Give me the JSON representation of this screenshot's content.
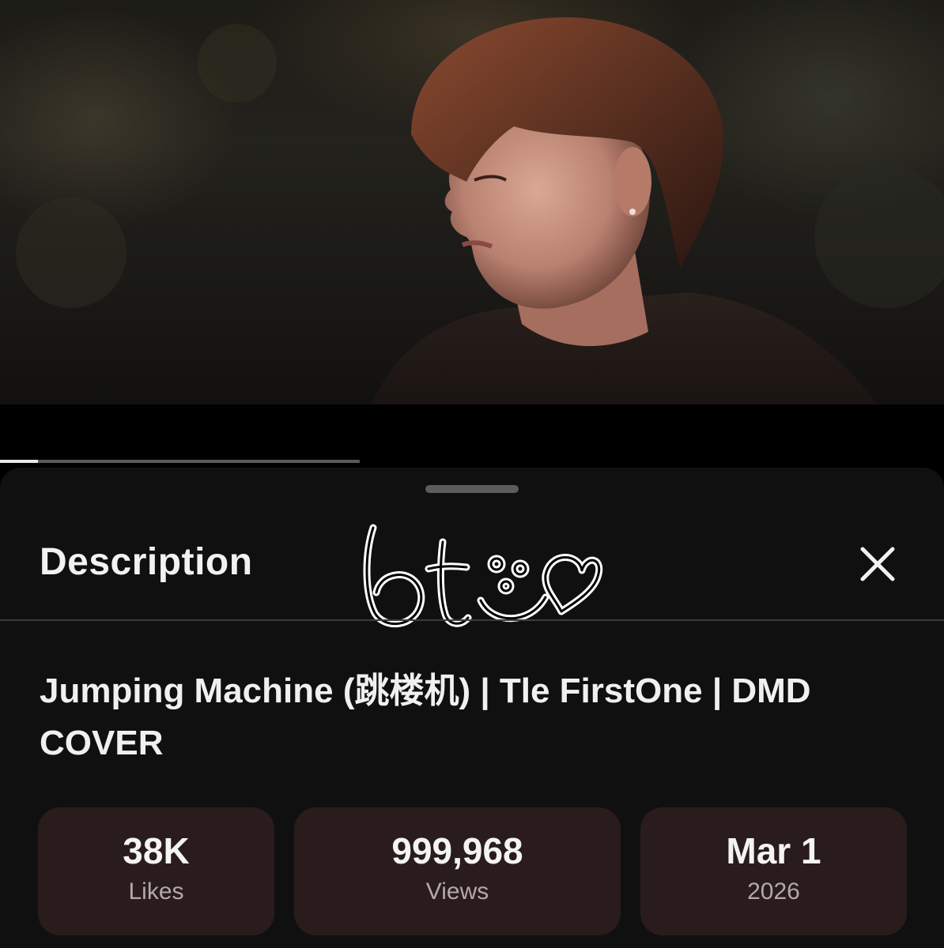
{
  "description_sheet": {
    "title": "Description",
    "video_title": "Jumping Machine (跳楼机) | Tle FirstOne | DMD COVER",
    "stats": [
      {
        "value": "38K",
        "label": "Likes"
      },
      {
        "value": "999,968",
        "label": "Views"
      },
      {
        "value": "Mar 1",
        "label": "2026"
      }
    ]
  },
  "player": {
    "progress": 0.04
  },
  "overlay": {
    "doodle_text": "bt"
  },
  "icons": {
    "close": "close-icon",
    "handle": "drag-handle",
    "doodle": "doodle-sticker"
  },
  "colors": {
    "sheet_background": "#111010",
    "stat_card": "#2a1c1c",
    "text_primary": "#f2f2f2",
    "text_secondary": "#b4a8a8"
  }
}
